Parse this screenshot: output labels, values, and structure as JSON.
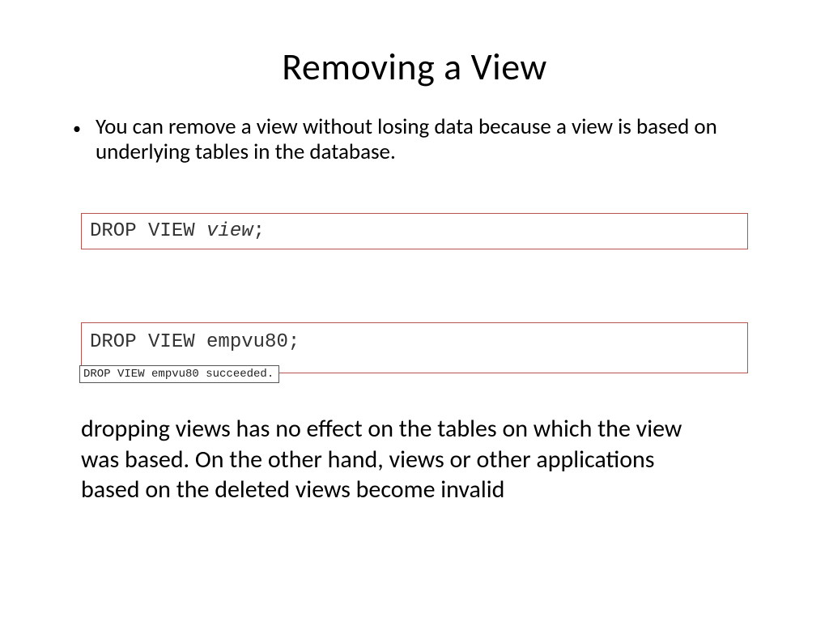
{
  "title": "Removing a View",
  "bullet": "You can remove a view without losing data because a view is based on underlying tables in the database.",
  "syntax": {
    "prefix": "DROP VIEW ",
    "param": "view",
    "suffix": ";"
  },
  "example": {
    "statement": "DROP VIEW empvu80;",
    "result": "DROP VIEW empvu80 succeeded."
  },
  "paragraph": "dropping views has no effect on the tables on which the view was based. On the other hand, views or other applications based on the deleted views become invalid"
}
